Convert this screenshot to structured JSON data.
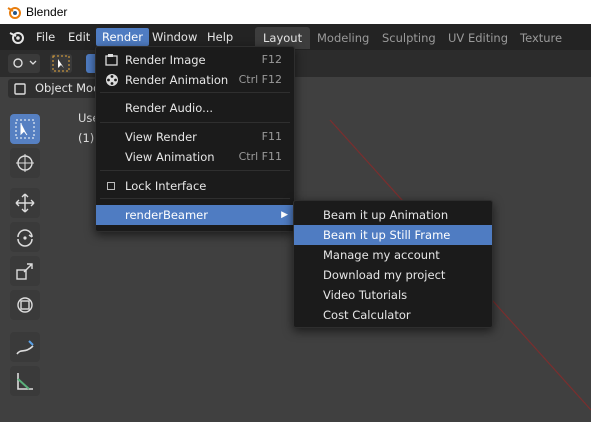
{
  "window": {
    "title": "Blender"
  },
  "menubar": {
    "items": [
      "File",
      "Edit",
      "Render",
      "Window",
      "Help"
    ]
  },
  "workspaces": [
    "Layout",
    "Modeling",
    "Sculpting",
    "UV Editing",
    "Texture Paint"
  ],
  "header": {
    "mode": "Object Mode"
  },
  "viewport": {
    "overlay_line1": "Use",
    "overlay_line2": "(1)"
  },
  "render_menu": {
    "items": [
      {
        "label": "Render Image",
        "shortcut": "F12",
        "icon": "render-image-icon"
      },
      {
        "label": "Render Animation",
        "shortcut": "Ctrl F12",
        "icon": "film-reel-icon"
      },
      {
        "label": "Render Audio...",
        "shortcut": ""
      },
      {
        "label": "View Render",
        "shortcut": "F11"
      },
      {
        "label": "View Animation",
        "shortcut": "Ctrl F11"
      },
      {
        "label": "Lock Interface",
        "shortcut": "",
        "checkbox": false
      },
      {
        "label": "renderBeamer",
        "shortcut": "",
        "submenu": true
      }
    ]
  },
  "submenu": {
    "items": [
      "Beam it up Animation",
      "Beam it up Still Frame",
      "Manage my account",
      "Download my project",
      "Video Tutorials",
      "Cost Calculator"
    ],
    "highlighted_index": 1
  },
  "colors": {
    "accent": "#4f7cc2",
    "menubar": "#232323",
    "menu_bg": "#1b1b1b",
    "viewport": "#404040"
  }
}
